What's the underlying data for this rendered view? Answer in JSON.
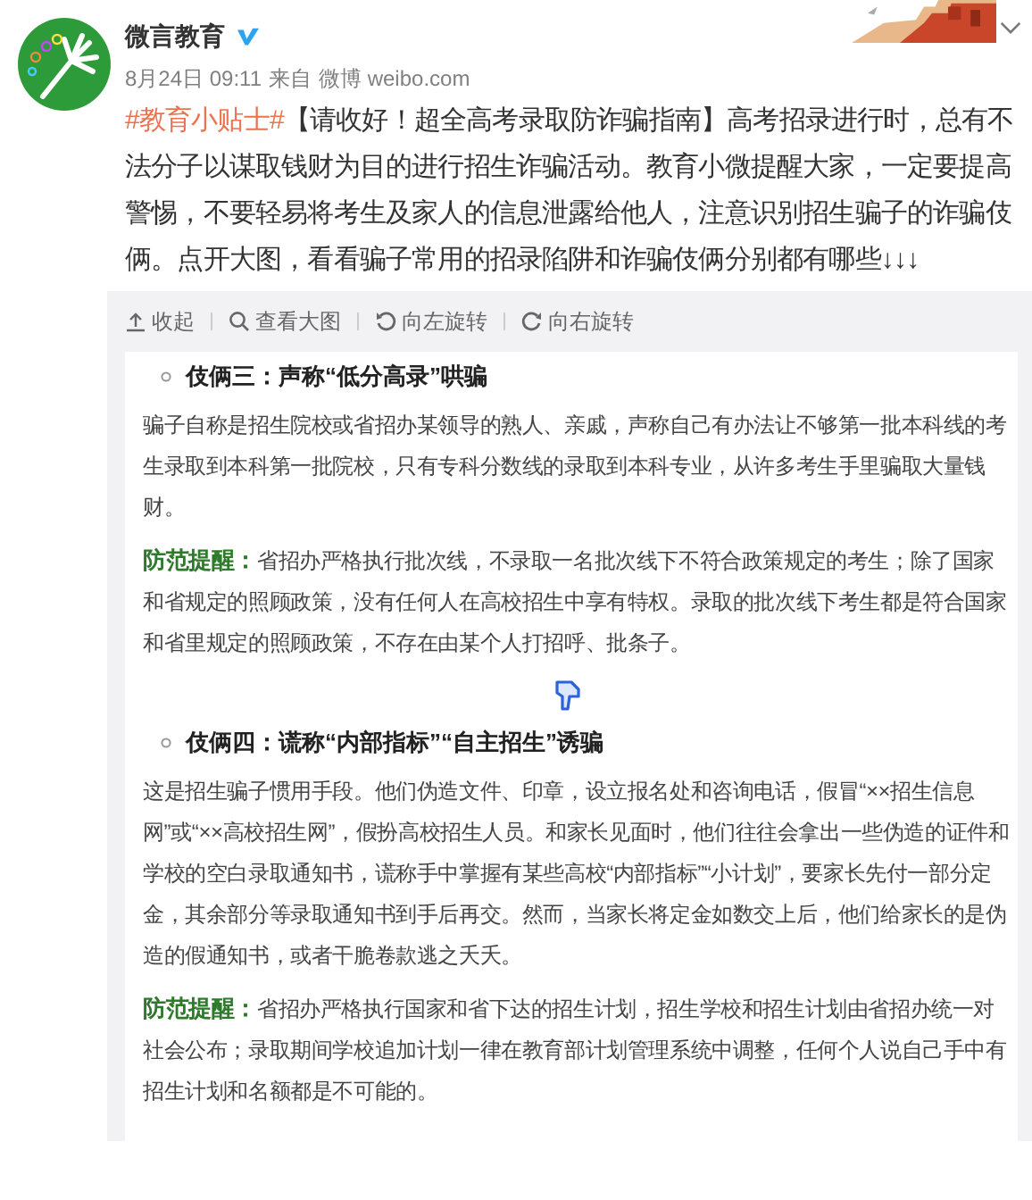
{
  "account": {
    "name": "微言教育",
    "verified": true
  },
  "post": {
    "time": "8月24日 09:11",
    "source_prefix": "来自",
    "source": "微博 weibo.com",
    "hashtag": "#教育小贴士#",
    "text": "【请收好！超全高考录取防诈骗指南】高考招录进行时，总有不法分子以谋取钱财为目的进行招生诈骗活动。教育小微提醒大家，一定要提高警惕，不要轻易将考生及家人的信息泄露给他人，注意识别招生骗子的诈骗伎俩。点开大图，看看骗子常用的招录陷阱和诈骗伎俩分别都有哪些↓↓↓"
  },
  "toolbar": [
    {
      "kind": "collapse",
      "label": "收起"
    },
    {
      "kind": "zoom",
      "label": "查看大图"
    },
    {
      "kind": "rotate_left",
      "label": "向左旋转"
    },
    {
      "kind": "rotate_right",
      "label": "向右旋转"
    }
  ],
  "article": [
    {
      "kind": "heading",
      "text": "伎俩三：声称“低分高录”哄骗"
    },
    {
      "kind": "paragraph",
      "text": "骗子自称是招生院校或省招办某领导的熟人、亲戚，声称自己有办法让不够第一批本科线的考生录取到本科第一批院校，只有专科分数线的录取到本科专业，从许多考生手里骗取大量钱财。"
    },
    {
      "kind": "tip",
      "label": "防范提醒：",
      "text": "省招办严格执行批次线，不录取一名批次线下不符合政策规定的考生；除了国家和省规定的照顾政策，没有任何人在高校招生中享有特权。录取的批次线下考生都是符合国家和省里规定的照顾政策，不存在由某个人打招呼、批条子。"
    },
    {
      "kind": "pointer"
    },
    {
      "kind": "heading",
      "text": "伎俩四：谎称“内部指标”“自主招生”诱骗"
    },
    {
      "kind": "paragraph",
      "text": "这是招生骗子惯用手段。他们伪造文件、印章，设立报名处和咨询电话，假冒“××招生信息网”或“××高校招生网”，假扮高校招生人员。和家长见面时，他们往往会拿出一些伪造的证件和学校的空白录取通知书，谎称手中掌握有某些高校“内部指标”“小计划”，要家长先付一部分定金，其余部分等录取通知书到手后再交。然而，当家长将定金如数交上后，他们给家长的是伪造的假通知书，或者干脆卷款逃之夭夭。"
    },
    {
      "kind": "tip",
      "label": "防范提醒：",
      "text": "省招办严格执行国家和省下达的招生计划，招生学校和招生计划由省招办统一对社会公布；录取期间学校追加计划一律在教育部计划管理系统中调整，任何个人说自己手中有招生计划和名额都是不可能的。"
    }
  ]
}
